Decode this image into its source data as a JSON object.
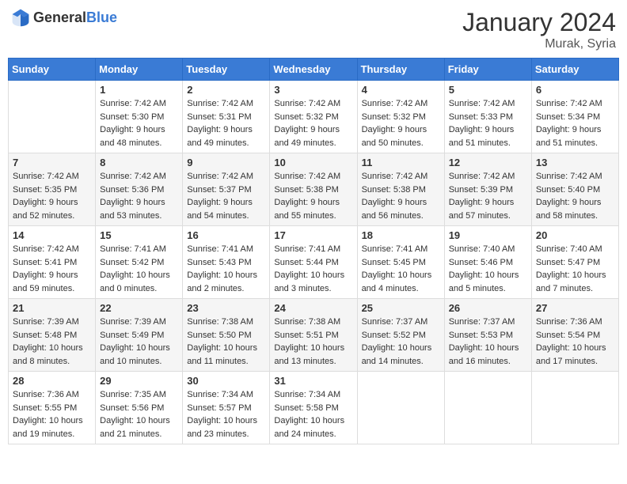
{
  "header": {
    "logo_general": "General",
    "logo_blue": "Blue",
    "month_year": "January 2024",
    "location": "Murak, Syria"
  },
  "weekdays": [
    "Sunday",
    "Monday",
    "Tuesday",
    "Wednesday",
    "Thursday",
    "Friday",
    "Saturday"
  ],
  "weeks": [
    [
      {
        "day": "",
        "sunrise": "",
        "sunset": "",
        "daylight": ""
      },
      {
        "day": "1",
        "sunrise": "Sunrise: 7:42 AM",
        "sunset": "Sunset: 5:30 PM",
        "daylight": "Daylight: 9 hours and 48 minutes."
      },
      {
        "day": "2",
        "sunrise": "Sunrise: 7:42 AM",
        "sunset": "Sunset: 5:31 PM",
        "daylight": "Daylight: 9 hours and 49 minutes."
      },
      {
        "day": "3",
        "sunrise": "Sunrise: 7:42 AM",
        "sunset": "Sunset: 5:32 PM",
        "daylight": "Daylight: 9 hours and 49 minutes."
      },
      {
        "day": "4",
        "sunrise": "Sunrise: 7:42 AM",
        "sunset": "Sunset: 5:32 PM",
        "daylight": "Daylight: 9 hours and 50 minutes."
      },
      {
        "day": "5",
        "sunrise": "Sunrise: 7:42 AM",
        "sunset": "Sunset: 5:33 PM",
        "daylight": "Daylight: 9 hours and 51 minutes."
      },
      {
        "day": "6",
        "sunrise": "Sunrise: 7:42 AM",
        "sunset": "Sunset: 5:34 PM",
        "daylight": "Daylight: 9 hours and 51 minutes."
      }
    ],
    [
      {
        "day": "7",
        "sunrise": "Sunrise: 7:42 AM",
        "sunset": "Sunset: 5:35 PM",
        "daylight": "Daylight: 9 hours and 52 minutes."
      },
      {
        "day": "8",
        "sunrise": "Sunrise: 7:42 AM",
        "sunset": "Sunset: 5:36 PM",
        "daylight": "Daylight: 9 hours and 53 minutes."
      },
      {
        "day": "9",
        "sunrise": "Sunrise: 7:42 AM",
        "sunset": "Sunset: 5:37 PM",
        "daylight": "Daylight: 9 hours and 54 minutes."
      },
      {
        "day": "10",
        "sunrise": "Sunrise: 7:42 AM",
        "sunset": "Sunset: 5:38 PM",
        "daylight": "Daylight: 9 hours and 55 minutes."
      },
      {
        "day": "11",
        "sunrise": "Sunrise: 7:42 AM",
        "sunset": "Sunset: 5:38 PM",
        "daylight": "Daylight: 9 hours and 56 minutes."
      },
      {
        "day": "12",
        "sunrise": "Sunrise: 7:42 AM",
        "sunset": "Sunset: 5:39 PM",
        "daylight": "Daylight: 9 hours and 57 minutes."
      },
      {
        "day": "13",
        "sunrise": "Sunrise: 7:42 AM",
        "sunset": "Sunset: 5:40 PM",
        "daylight": "Daylight: 9 hours and 58 minutes."
      }
    ],
    [
      {
        "day": "14",
        "sunrise": "Sunrise: 7:42 AM",
        "sunset": "Sunset: 5:41 PM",
        "daylight": "Daylight: 9 hours and 59 minutes."
      },
      {
        "day": "15",
        "sunrise": "Sunrise: 7:41 AM",
        "sunset": "Sunset: 5:42 PM",
        "daylight": "Daylight: 10 hours and 0 minutes."
      },
      {
        "day": "16",
        "sunrise": "Sunrise: 7:41 AM",
        "sunset": "Sunset: 5:43 PM",
        "daylight": "Daylight: 10 hours and 2 minutes."
      },
      {
        "day": "17",
        "sunrise": "Sunrise: 7:41 AM",
        "sunset": "Sunset: 5:44 PM",
        "daylight": "Daylight: 10 hours and 3 minutes."
      },
      {
        "day": "18",
        "sunrise": "Sunrise: 7:41 AM",
        "sunset": "Sunset: 5:45 PM",
        "daylight": "Daylight: 10 hours and 4 minutes."
      },
      {
        "day": "19",
        "sunrise": "Sunrise: 7:40 AM",
        "sunset": "Sunset: 5:46 PM",
        "daylight": "Daylight: 10 hours and 5 minutes."
      },
      {
        "day": "20",
        "sunrise": "Sunrise: 7:40 AM",
        "sunset": "Sunset: 5:47 PM",
        "daylight": "Daylight: 10 hours and 7 minutes."
      }
    ],
    [
      {
        "day": "21",
        "sunrise": "Sunrise: 7:39 AM",
        "sunset": "Sunset: 5:48 PM",
        "daylight": "Daylight: 10 hours and 8 minutes."
      },
      {
        "day": "22",
        "sunrise": "Sunrise: 7:39 AM",
        "sunset": "Sunset: 5:49 PM",
        "daylight": "Daylight: 10 hours and 10 minutes."
      },
      {
        "day": "23",
        "sunrise": "Sunrise: 7:38 AM",
        "sunset": "Sunset: 5:50 PM",
        "daylight": "Daylight: 10 hours and 11 minutes."
      },
      {
        "day": "24",
        "sunrise": "Sunrise: 7:38 AM",
        "sunset": "Sunset: 5:51 PM",
        "daylight": "Daylight: 10 hours and 13 minutes."
      },
      {
        "day": "25",
        "sunrise": "Sunrise: 7:37 AM",
        "sunset": "Sunset: 5:52 PM",
        "daylight": "Daylight: 10 hours and 14 minutes."
      },
      {
        "day": "26",
        "sunrise": "Sunrise: 7:37 AM",
        "sunset": "Sunset: 5:53 PM",
        "daylight": "Daylight: 10 hours and 16 minutes."
      },
      {
        "day": "27",
        "sunrise": "Sunrise: 7:36 AM",
        "sunset": "Sunset: 5:54 PM",
        "daylight": "Daylight: 10 hours and 17 minutes."
      }
    ],
    [
      {
        "day": "28",
        "sunrise": "Sunrise: 7:36 AM",
        "sunset": "Sunset: 5:55 PM",
        "daylight": "Daylight: 10 hours and 19 minutes."
      },
      {
        "day": "29",
        "sunrise": "Sunrise: 7:35 AM",
        "sunset": "Sunset: 5:56 PM",
        "daylight": "Daylight: 10 hours and 21 minutes."
      },
      {
        "day": "30",
        "sunrise": "Sunrise: 7:34 AM",
        "sunset": "Sunset: 5:57 PM",
        "daylight": "Daylight: 10 hours and 23 minutes."
      },
      {
        "day": "31",
        "sunrise": "Sunrise: 7:34 AM",
        "sunset": "Sunset: 5:58 PM",
        "daylight": "Daylight: 10 hours and 24 minutes."
      },
      {
        "day": "",
        "sunrise": "",
        "sunset": "",
        "daylight": ""
      },
      {
        "day": "",
        "sunrise": "",
        "sunset": "",
        "daylight": ""
      },
      {
        "day": "",
        "sunrise": "",
        "sunset": "",
        "daylight": ""
      }
    ]
  ]
}
